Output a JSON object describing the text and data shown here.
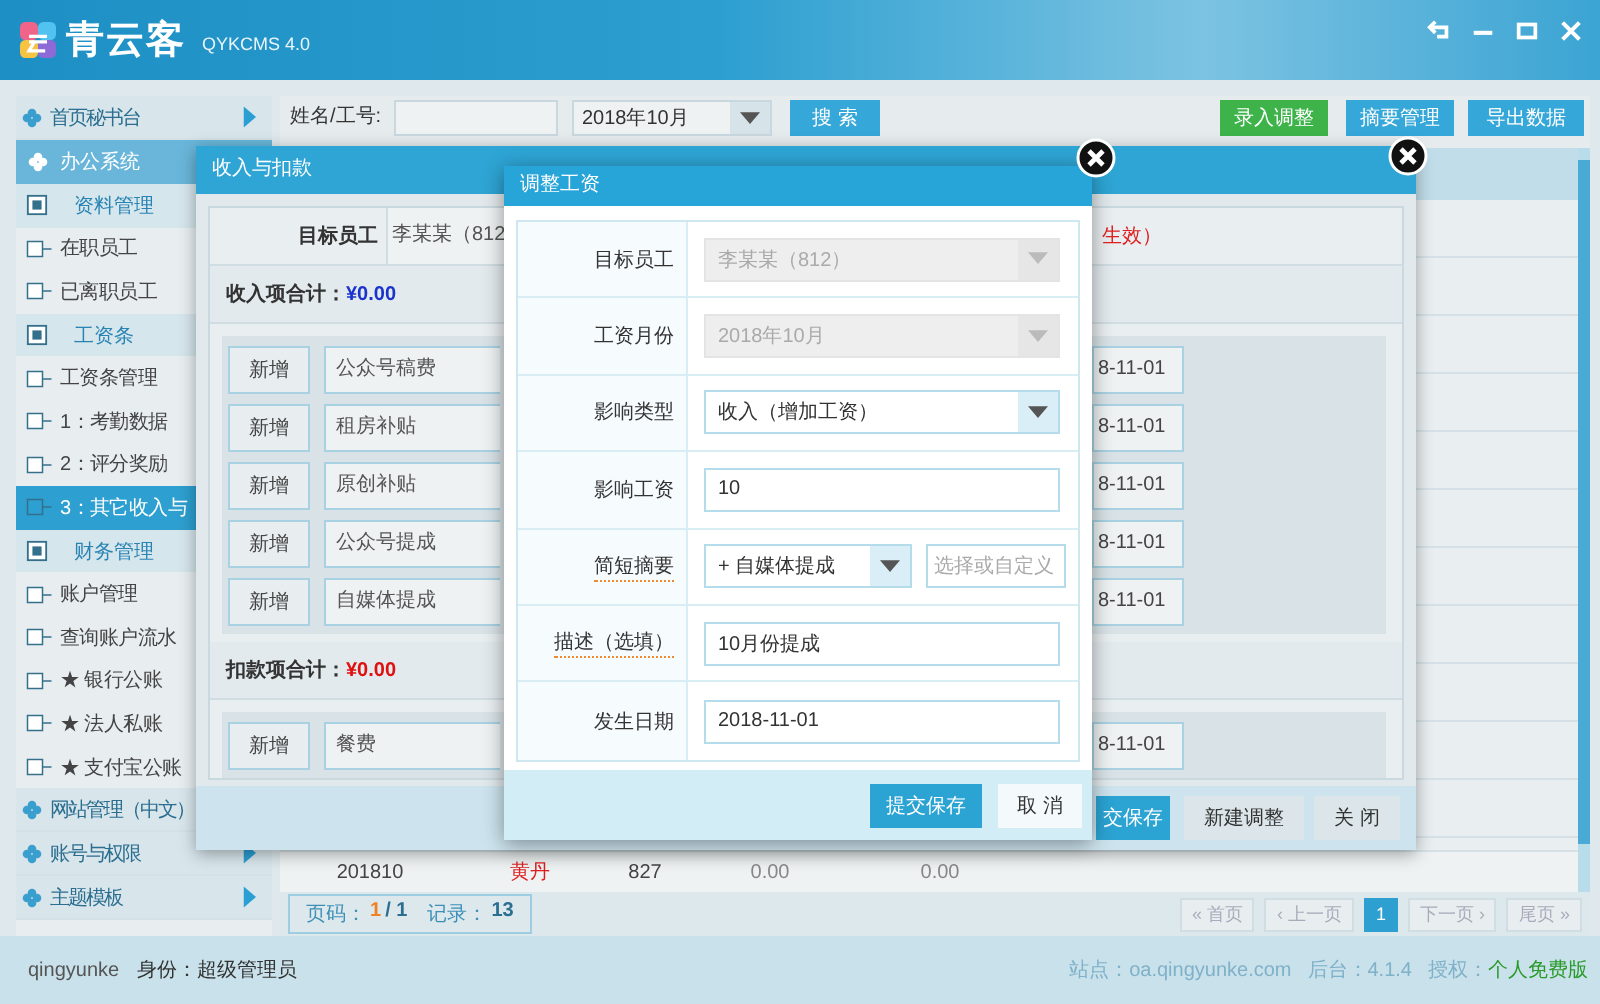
{
  "app": {
    "name": "青云客",
    "version": "QYKCMS 4.0"
  },
  "sidebar": {
    "items": [
      {
        "label": "首页秘书台",
        "kind": "menu",
        "arrow": true
      },
      {
        "label": "办公系统",
        "kind": "section",
        "children": [
          {
            "label": "资料管理",
            "children": [
              {
                "label": "在职员工",
                "selected": false
              },
              {
                "label": "已离职员工",
                "selected": false
              }
            ]
          },
          {
            "label": "工资条",
            "children": [
              {
                "label": "工资条管理",
                "selected": false
              },
              {
                "label": "1：考勤数据",
                "selected": false
              },
              {
                "label": "2：评分奖励",
                "selected": false
              },
              {
                "label": "3：其它收入与",
                "selected": true
              }
            ]
          },
          {
            "label": "财务管理",
            "children": [
              {
                "label": "账户管理",
                "selected": false
              },
              {
                "label": "查询账户流水",
                "selected": false
              },
              {
                "label": "★ 银行公账",
                "selected": false
              },
              {
                "label": "★ 法人私账",
                "selected": false
              },
              {
                "label": "★ 支付宝公账",
                "selected": false
              }
            ]
          }
        ]
      },
      {
        "label": "网站管理（中文）",
        "kind": "menu"
      },
      {
        "label": "账号与权限",
        "kind": "menu",
        "arrow": true
      },
      {
        "label": "主题模板",
        "kind": "menu",
        "arrow": true
      }
    ]
  },
  "toolbar": {
    "name_label": "姓名/工号:",
    "month": "2018年10月",
    "search_button": "搜 索",
    "actions": [
      {
        "label": "录入调整",
        "kind": "primary"
      },
      {
        "label": "摘要管理",
        "kind": "default"
      },
      {
        "label": "导出数据",
        "kind": "default"
      }
    ]
  },
  "table": {
    "rows": [
      {
        "cells": [
          "201810",
          "黄丹",
          "827",
          "0.00",
          "0.00"
        ]
      }
    ]
  },
  "pagination": {
    "page_label": "页码：",
    "page": "1",
    "page_total": "/ 1",
    "records_label": "记录：",
    "records": "13",
    "buttons": [
      {
        "label": "« 首页",
        "selected": false
      },
      {
        "label": "‹ 上一页",
        "selected": false
      },
      {
        "label": "1",
        "selected": true
      },
      {
        "label": "下一页 ›",
        "selected": false
      },
      {
        "label": "尾页 »",
        "selected": false
      }
    ]
  },
  "income_dialog": {
    "title": "收入与扣款",
    "target_label": "目标员工",
    "target_value": "李某某（812",
    "status_note": "生效）",
    "sections": [
      {
        "kind": "income",
        "label": "收入项合计：",
        "amount": "¥0.00",
        "rows": [
          {
            "button": "新增",
            "item": "公众号稿费",
            "date": "8-11-01"
          },
          {
            "button": "新增",
            "item": "租房补贴",
            "date": "8-11-01"
          },
          {
            "button": "新增",
            "item": "原创补贴",
            "date": "8-11-01"
          },
          {
            "button": "新增",
            "item": "公众号提成",
            "date": "8-11-01"
          },
          {
            "button": "新增",
            "item": "自媒体提成",
            "date": "8-11-01"
          }
        ]
      },
      {
        "kind": "deduction",
        "label": "扣款项合计：",
        "amount": "¥0.00",
        "rows": [
          {
            "button": "新增",
            "item": "餐费",
            "date": "8-11-01"
          }
        ]
      }
    ],
    "buttons": [
      {
        "label": "交保存",
        "kind": "primary"
      },
      {
        "label": "新建调整",
        "kind": "default"
      },
      {
        "label": "关 闭",
        "kind": "default"
      }
    ]
  },
  "adjust_dialog": {
    "title": "调整工资",
    "fields": [
      {
        "label": "目标员工",
        "kind": "select",
        "value": "李某某（812）",
        "disabled": true,
        "hint": false
      },
      {
        "label": "工资月份",
        "kind": "select",
        "value": "2018年10月",
        "disabled": true,
        "hint": false
      },
      {
        "label": "影响类型",
        "kind": "select",
        "value": "收入（增加工资）",
        "disabled": false,
        "hint": false
      },
      {
        "label": "影响工资",
        "kind": "input",
        "value": "10",
        "disabled": false,
        "hint": false
      },
      {
        "label": "简短摘要",
        "kind": "combo",
        "value": "+ 自媒体提成",
        "placeholder": "选择或自定义",
        "disabled": false,
        "hint": true
      },
      {
        "label": "描述（选填）",
        "kind": "input",
        "value": "10月份提成",
        "disabled": false,
        "hint": true
      },
      {
        "label": "发生日期",
        "kind": "input",
        "value": "2018-11-01",
        "disabled": false,
        "hint": false
      }
    ],
    "buttons": [
      {
        "label": "提交保存",
        "kind": "primary"
      },
      {
        "label": "取 消",
        "kind": "default"
      }
    ]
  },
  "status_bar": {
    "user": "qingyunke",
    "role": "身份：超级管理员",
    "site": "站点：oa.qingyunke.com",
    "backend": "后台：4.1.4",
    "license_label": "授权：",
    "license": "个人免费版"
  }
}
